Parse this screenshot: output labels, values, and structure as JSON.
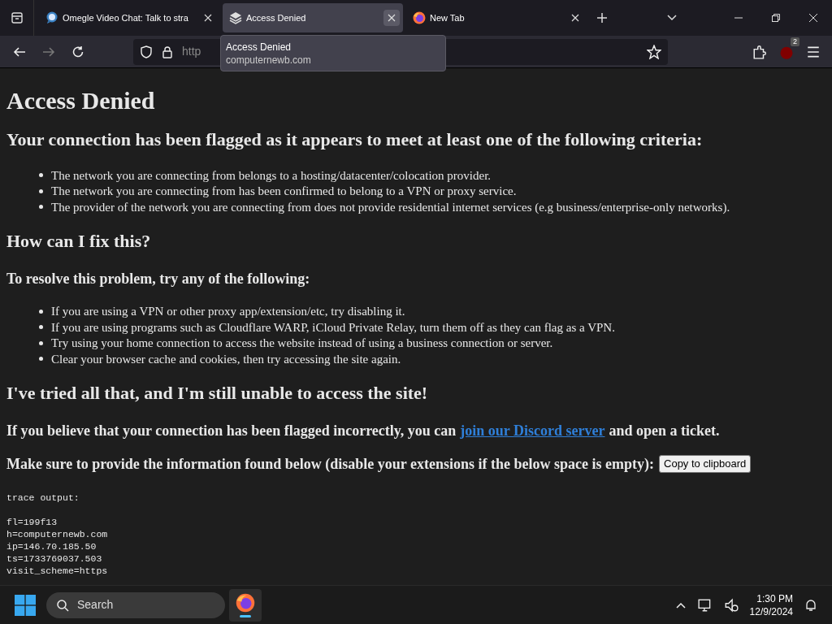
{
  "tabs": [
    {
      "title": "Omegle Video Chat: Talk to stra",
      "kind": "globe",
      "selected": false
    },
    {
      "title": "Access Denied",
      "kind": "stack",
      "selected": true
    },
    {
      "title": "New Tab",
      "kind": "firefox",
      "selected": false
    }
  ],
  "tooltip": {
    "title": "Access Denied",
    "url": "computernewb.com"
  },
  "toolbar": {
    "address": "http",
    "badge": "2"
  },
  "content": [
    {
      "kind": "h1",
      "text": "Access Denied"
    },
    {
      "kind": "h2",
      "text": "Your connection has been flagged as it appears to meet at least one of the following criteria:"
    },
    {
      "kind": "list",
      "items": [
        "The network you are connecting from belongs to a hosting/datacenter/colocation provider.",
        "The network you are connecting from has been confirmed to belong to a VPN or proxy service.",
        "The provider of the network you are connecting from does not provide residential internet services (e.g business/enterprise-only networks)."
      ]
    },
    {
      "kind": "h2",
      "text": "How can I fix this?"
    },
    {
      "kind": "h3",
      "text": "To resolve this problem, try any of the following:"
    },
    {
      "kind": "list",
      "items": [
        "If you are using a VPN or other proxy app/extension/etc, try disabling it.",
        "If you are using programs such as Cloudflare WARP, iCloud Private Relay, turn them off as they can flag as a VPN.",
        "Try using your home connection to access the website instead of using a business connection or server.",
        "Clear your browser cache and cookies, then try accessing the site again."
      ]
    },
    {
      "kind": "h2",
      "text": "I've tried all that, and I'm still unable to access the site!"
    },
    {
      "kind": "link_para",
      "before": "If you believe that your connection has been flagged incorrectly, you can",
      "link": "join our Discord server",
      "after": "and open a ticket."
    },
    {
      "kind": "button_para",
      "text": "Make sure to provide the information found below (disable your extensions if the below space is empty):",
      "button": "Copy to clipboard"
    },
    {
      "kind": "pre",
      "header": "trace output:",
      "lines": [
        "fl=199f13",
        "h=computernewb.com",
        "ip=146.70.185.50",
        "ts=1733769037.503",
        "visit_scheme=https"
      ]
    }
  ],
  "taskbar": {
    "search": "Search",
    "time": "1:30 PM",
    "date": "12/9/2024"
  }
}
